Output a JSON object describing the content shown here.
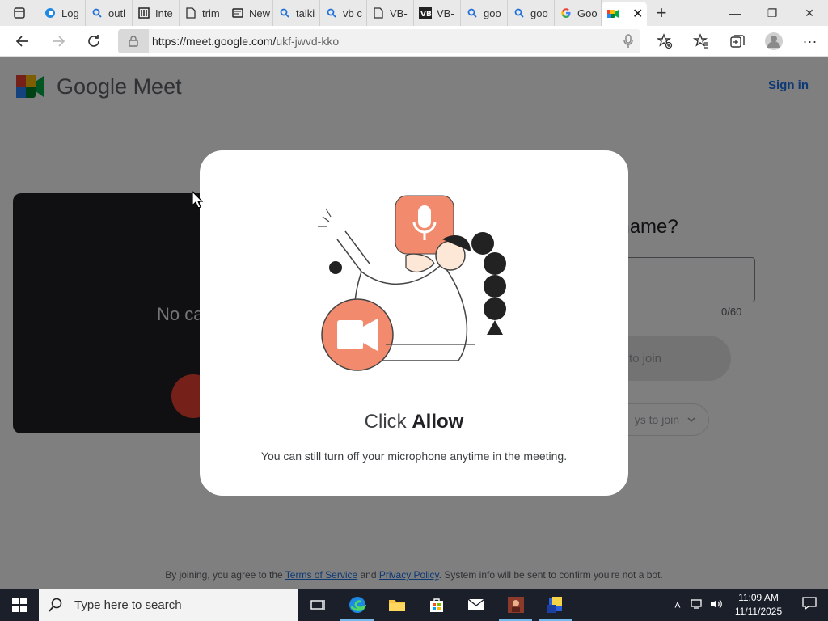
{
  "browser": {
    "tabs": [
      {
        "label": "Log",
        "icon": "edge-icon"
      },
      {
        "label": "outl",
        "icon": "search-icon"
      },
      {
        "label": "Inte",
        "icon": "library-icon"
      },
      {
        "label": "trim",
        "icon": "document-icon"
      },
      {
        "label": "New",
        "icon": "newsletter-icon"
      },
      {
        "label": "talki",
        "icon": "search-icon"
      },
      {
        "label": "vb c",
        "icon": "search-icon"
      },
      {
        "label": "VB-",
        "icon": "document-icon"
      },
      {
        "label": "VB-",
        "icon": "vb-icon"
      },
      {
        "label": "goo",
        "icon": "search-icon"
      },
      {
        "label": "goo",
        "icon": "search-icon"
      },
      {
        "label": "Goo",
        "icon": "google-icon"
      },
      {
        "label": "",
        "icon": "meet-icon",
        "active": true
      }
    ],
    "url_host": "https://meet.google.com/",
    "url_path": "ukf-jwvd-kko"
  },
  "page": {
    "brand": "Google Meet",
    "sign_in": "Sign in",
    "preview_text": "No ca",
    "name_prompt": "your name?",
    "name_count": "0/60",
    "join_label": "to join",
    "other_ways": "ys to join",
    "footer": {
      "prefix": "By joining, you agree to the ",
      "tos": "Terms of Service",
      "and": " and ",
      "privacy": "Privacy Policy",
      "suffix": ". System info will be sent to confirm you're not a bot."
    }
  },
  "dialog": {
    "title_prefix": "Click ",
    "title_bold": "Allow",
    "subtitle": "You can still turn off your microphone anytime in the meeting."
  },
  "taskbar": {
    "search_placeholder": "Type here to search",
    "time": "11:09 AM",
    "date": "11/11/2025"
  },
  "colors": {
    "accent_blue": "#1a73e8",
    "illustration_orange": "#f28b6e",
    "mic_red": "#ea4335"
  }
}
